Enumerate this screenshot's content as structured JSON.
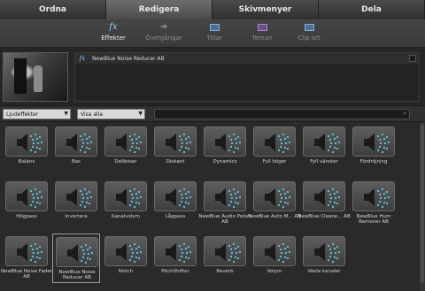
{
  "tabs": [
    {
      "label": "Ordna",
      "active": false
    },
    {
      "label": "Redigera",
      "active": true
    },
    {
      "label": "Skivmenyer",
      "active": false
    },
    {
      "label": "Dela",
      "active": false
    }
  ],
  "toolbar": {
    "items": [
      {
        "label": "Effekter",
        "icon": "fx-icon",
        "active": true
      },
      {
        "label": "Övergångar",
        "icon": "arrow-right-icon",
        "active": false
      },
      {
        "label": "Titlar",
        "icon": "title-icon",
        "active": false
      },
      {
        "label": "Teman",
        "icon": "theme-icon",
        "active": false
      },
      {
        "label": "Clip art",
        "icon": "clipart-icon",
        "active": false
      }
    ]
  },
  "preview": {
    "fx_label": "fx",
    "effect_name": "NewBlue Noise Reducer AB"
  },
  "filters": {
    "category": "Ljudeffekter",
    "view": "Visa alla",
    "search_value": ""
  },
  "effects": [
    "Balans",
    "Bas",
    "DeNoiser",
    "Diskant",
    "Dynamics",
    "Fyll höger",
    "Fyll vänster",
    "Fördröjning",
    "Högpass",
    "Invertera",
    "Kanalvolym",
    "Lågpass",
    "NewBlue Audio Polish AB",
    "NewBlue Auto M... AB",
    "NewBlue Cleane... AB",
    "NewBlue Hum Remover AB",
    "NewBlue Noise Fader AB",
    "NewBlue Noise Reducer AB",
    "Notch",
    "PitchShifter",
    "Reverb",
    "Volym",
    "Växla kanaler"
  ],
  "selected_effect": "NewBlue Noise Reducer AB",
  "colors": {
    "accent": "#8fd0ff",
    "speaker": "#1a1a1a",
    "waves": "#62c6e6"
  }
}
